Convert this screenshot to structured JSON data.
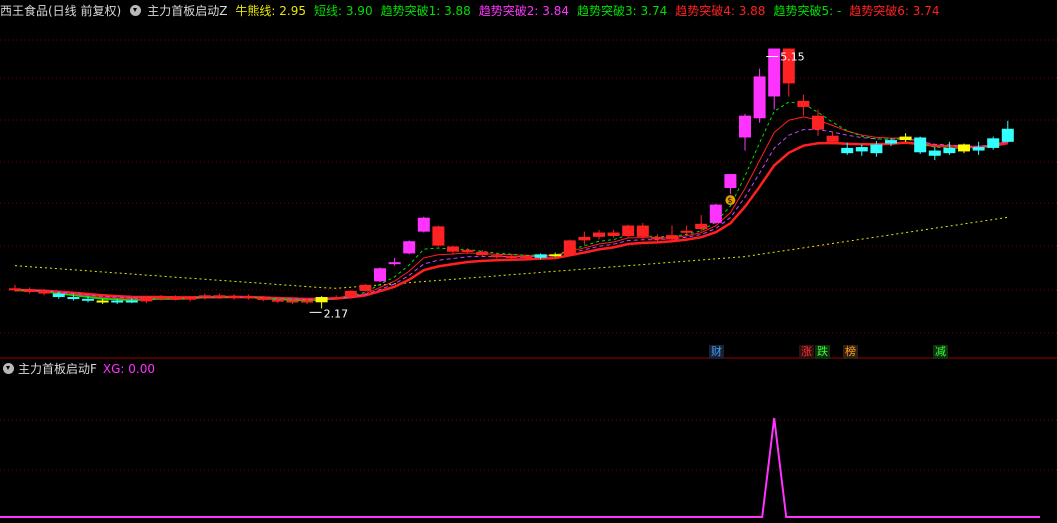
{
  "header": {
    "stock_name": "西王食品(日线 前复权)",
    "indicator_name": "主力首板启动Z",
    "items": [
      {
        "label": "牛熊线:",
        "value": "2.95",
        "color": "#e8e800"
      },
      {
        "label": "短线:",
        "value": "3.90",
        "color": "#00e000"
      },
      {
        "label": "趋势突破1:",
        "value": "3.88",
        "color": "#00e000"
      },
      {
        "label": "趋势突破2:",
        "value": "3.84",
        "color": "#ff33ff"
      },
      {
        "label": "趋势突破3:",
        "value": "3.74",
        "color": "#00e000"
      },
      {
        "label": "趋势突破4:",
        "value": "3.88",
        "color": "#ff2020"
      },
      {
        "label": "趋势突破5:",
        "value": "-",
        "color": "#00e000"
      },
      {
        "label": "趋势突破6:",
        "value": "3.74",
        "color": "#ff2020"
      }
    ]
  },
  "sub_header": {
    "indicator_name": "主力首板启动F",
    "xg_label": "XG:",
    "xg_value": "0.00",
    "xg_color": "#ff33ff"
  },
  "badges": [
    {
      "text": "财",
      "color": "#3aa0ff",
      "bg": "#1a2030"
    },
    {
      "text": "涨",
      "color": "#ff3030",
      "bg": "#301010"
    },
    {
      "text": "跌",
      "color": "#30ff30",
      "bg": "#103010"
    },
    {
      "text": "榜",
      "color": "#ffa020",
      "bg": "#302010"
    },
    {
      "text": "减",
      "color": "#30ff30",
      "bg": "#103010"
    }
  ],
  "chart_data": {
    "type": "candlestick",
    "ylim": [
      1.75,
      5.5
    ],
    "max_label": "5.15",
    "min_label": "2.17",
    "candles": [
      {
        "o": 2.4,
        "h": 2.44,
        "l": 2.36,
        "c": 2.38,
        "col": "r"
      },
      {
        "o": 2.38,
        "h": 2.41,
        "l": 2.34,
        "c": 2.37,
        "col": "r"
      },
      {
        "o": 2.37,
        "h": 2.39,
        "l": 2.32,
        "c": 2.34,
        "col": "r"
      },
      {
        "o": 2.34,
        "h": 2.36,
        "l": 2.28,
        "c": 2.3,
        "col": "c"
      },
      {
        "o": 2.3,
        "h": 2.33,
        "l": 2.26,
        "c": 2.28,
        "col": "c"
      },
      {
        "o": 2.28,
        "h": 2.31,
        "l": 2.24,
        "c": 2.26,
        "col": "c"
      },
      {
        "o": 2.26,
        "h": 2.28,
        "l": 2.22,
        "c": 2.24,
        "col": "y"
      },
      {
        "o": 2.24,
        "h": 2.28,
        "l": 2.22,
        "c": 2.26,
        "col": "c"
      },
      {
        "o": 2.26,
        "h": 2.29,
        "l": 2.23,
        "c": 2.25,
        "col": "c"
      },
      {
        "o": 2.25,
        "h": 2.31,
        "l": 2.23,
        "c": 2.29,
        "col": "r"
      },
      {
        "o": 2.29,
        "h": 2.32,
        "l": 2.26,
        "c": 2.3,
        "col": "r"
      },
      {
        "o": 2.3,
        "h": 2.32,
        "l": 2.26,
        "c": 2.27,
        "col": "r"
      },
      {
        "o": 2.27,
        "h": 2.31,
        "l": 2.25,
        "c": 2.3,
        "col": "r"
      },
      {
        "o": 2.3,
        "h": 2.34,
        "l": 2.27,
        "c": 2.32,
        "col": "r"
      },
      {
        "o": 2.32,
        "h": 2.34,
        "l": 2.28,
        "c": 2.3,
        "col": "r"
      },
      {
        "o": 2.3,
        "h": 2.33,
        "l": 2.27,
        "c": 2.31,
        "col": "r"
      },
      {
        "o": 2.31,
        "h": 2.33,
        "l": 2.27,
        "c": 2.29,
        "col": "r"
      },
      {
        "o": 2.29,
        "h": 2.31,
        "l": 2.25,
        "c": 2.27,
        "col": "r"
      },
      {
        "o": 2.27,
        "h": 2.29,
        "l": 2.23,
        "c": 2.25,
        "col": "r"
      },
      {
        "o": 2.25,
        "h": 2.28,
        "l": 2.22,
        "c": 2.26,
        "col": "r"
      },
      {
        "o": 2.26,
        "h": 2.28,
        "l": 2.22,
        "c": 2.24,
        "col": "r"
      },
      {
        "o": 2.24,
        "h": 2.31,
        "l": 2.17,
        "c": 2.3,
        "col": "y"
      },
      {
        "o": 2.3,
        "h": 2.32,
        "l": 2.27,
        "c": 2.3,
        "col": "r"
      },
      {
        "o": 2.3,
        "h": 2.38,
        "l": 2.29,
        "c": 2.37,
        "col": "r"
      },
      {
        "o": 2.37,
        "h": 2.45,
        "l": 2.36,
        "c": 2.44,
        "col": "r"
      },
      {
        "o": 2.48,
        "h": 2.64,
        "l": 2.47,
        "c": 2.63,
        "col": "m"
      },
      {
        "o": 2.68,
        "h": 2.75,
        "l": 2.66,
        "c": 2.7,
        "col": "m"
      },
      {
        "o": 2.8,
        "h": 2.95,
        "l": 2.79,
        "c": 2.94,
        "col": "m"
      },
      {
        "o": 3.05,
        "h": 3.22,
        "l": 3.04,
        "c": 3.21,
        "col": "m"
      },
      {
        "o": 3.11,
        "h": 3.12,
        "l": 2.88,
        "c": 2.89,
        "col": "r"
      },
      {
        "o": 2.88,
        "h": 2.89,
        "l": 2.8,
        "c": 2.82,
        "col": "r"
      },
      {
        "o": 2.83,
        "h": 2.86,
        "l": 2.8,
        "c": 2.84,
        "col": "r"
      },
      {
        "o": 2.82,
        "h": 2.84,
        "l": 2.76,
        "c": 2.78,
        "col": "r"
      },
      {
        "o": 2.78,
        "h": 2.8,
        "l": 2.74,
        "c": 2.76,
        "col": "r"
      },
      {
        "o": 2.76,
        "h": 2.79,
        "l": 2.72,
        "c": 2.77,
        "col": "r"
      },
      {
        "o": 2.77,
        "h": 2.79,
        "l": 2.73,
        "c": 2.75,
        "col": "r"
      },
      {
        "o": 2.75,
        "h": 2.8,
        "l": 2.73,
        "c": 2.79,
        "col": "c"
      },
      {
        "o": 2.79,
        "h": 2.81,
        "l": 2.76,
        "c": 2.78,
        "col": "y"
      },
      {
        "o": 2.78,
        "h": 2.96,
        "l": 2.77,
        "c": 2.95,
        "col": "r"
      },
      {
        "o": 2.95,
        "h": 3.05,
        "l": 2.9,
        "c": 2.99,
        "col": "r"
      },
      {
        "o": 2.99,
        "h": 3.07,
        "l": 2.96,
        "c": 3.04,
        "col": "r"
      },
      {
        "o": 3.04,
        "h": 3.07,
        "l": 2.98,
        "c": 3.0,
        "col": "r"
      },
      {
        "o": 3.0,
        "h": 3.13,
        "l": 2.98,
        "c": 3.12,
        "col": "r"
      },
      {
        "o": 3.12,
        "h": 3.15,
        "l": 2.97,
        "c": 2.99,
        "col": "r"
      },
      {
        "o": 2.99,
        "h": 3.02,
        "l": 2.94,
        "c": 2.96,
        "col": "r"
      },
      {
        "o": 2.96,
        "h": 3.12,
        "l": 2.95,
        "c": 3.01,
        "col": "r"
      },
      {
        "o": 3.05,
        "h": 3.12,
        "l": 3.0,
        "c": 3.06,
        "col": "r"
      },
      {
        "o": 3.08,
        "h": 3.24,
        "l": 3.05,
        "c": 3.14,
        "col": "r"
      },
      {
        "o": 3.15,
        "h": 3.37,
        "l": 3.14,
        "c": 3.36,
        "col": "m"
      },
      {
        "o": 3.55,
        "h": 3.71,
        "l": 3.48,
        "c": 3.71,
        "col": "m"
      },
      {
        "o": 4.13,
        "h": 4.4,
        "l": 3.98,
        "c": 4.38,
        "col": "m"
      },
      {
        "o": 4.35,
        "h": 4.92,
        "l": 4.3,
        "c": 4.83,
        "col": "m"
      },
      {
        "o": 4.6,
        "h": 5.15,
        "l": 4.45,
        "c": 5.15,
        "col": "m"
      },
      {
        "o": 5.15,
        "h": 5.15,
        "l": 4.6,
        "c": 4.75,
        "col": "r"
      },
      {
        "o": 4.55,
        "h": 4.62,
        "l": 4.38,
        "c": 4.48,
        "col": "r"
      },
      {
        "o": 4.38,
        "h": 4.45,
        "l": 4.15,
        "c": 4.22,
        "col": "r"
      },
      {
        "o": 4.15,
        "h": 4.2,
        "l": 4.05,
        "c": 4.08,
        "col": "r"
      },
      {
        "o": 3.95,
        "h": 4.07,
        "l": 3.93,
        "c": 4.01,
        "col": "c"
      },
      {
        "o": 3.97,
        "h": 4.05,
        "l": 3.92,
        "c": 4.02,
        "col": "c"
      },
      {
        "o": 3.95,
        "h": 4.09,
        "l": 3.91,
        "c": 4.05,
        "col": "c"
      },
      {
        "o": 4.06,
        "h": 4.12,
        "l": 4.03,
        "c": 4.1,
        "col": "c"
      },
      {
        "o": 4.1,
        "h": 4.18,
        "l": 4.08,
        "c": 4.14,
        "col": "y"
      },
      {
        "o": 4.13,
        "h": 4.14,
        "l": 3.94,
        "c": 3.96,
        "col": "c"
      },
      {
        "o": 3.98,
        "h": 4.02,
        "l": 3.87,
        "c": 3.92,
        "col": "c"
      },
      {
        "o": 3.95,
        "h": 4.08,
        "l": 3.93,
        "c": 4.01,
        "col": "c"
      },
      {
        "o": 4.05,
        "h": 4.06,
        "l": 3.95,
        "c": 3.97,
        "col": "y"
      },
      {
        "o": 3.98,
        "h": 4.08,
        "l": 3.93,
        "c": 4.02,
        "col": "c"
      },
      {
        "o": 4.01,
        "h": 4.14,
        "l": 3.99,
        "c": 4.12,
        "col": "c"
      },
      {
        "o": 4.08,
        "h": 4.32,
        "l": 4.07,
        "c": 4.23,
        "col": "c"
      }
    ],
    "annotations": [
      {
        "candle_index": 49,
        "glyph": "$"
      }
    ],
    "sub_chart": {
      "type": "line",
      "series_name": "XG",
      "x": [
        0,
        67
      ],
      "spike_at": 52,
      "values_note": "0 everywhere except 1 at spike",
      "ylim": [
        0,
        1
      ]
    }
  }
}
